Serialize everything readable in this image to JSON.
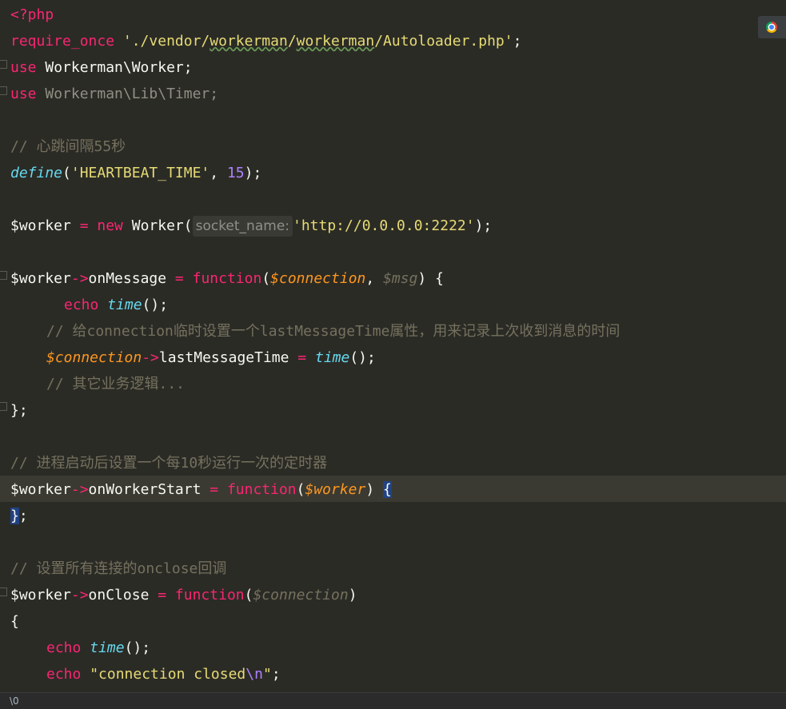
{
  "code": {
    "l1_open": "<?php",
    "l2_require": "require_once",
    "l2_path_a": " './vendor/",
    "l2_path_b": "workerman",
    "l2_path_c": "/",
    "l2_path_d": "workerman",
    "l2_path_e": "/Autoloader.php'",
    "l2_semi": ";",
    "l3_use": "use",
    "l3_ns": " Workerman\\Worker;",
    "l4_use": "use",
    "l4_ns": " Workerman\\Lib\\Timer;",
    "l6_comment": "// 心跳间隔55秒",
    "l7_define": "define",
    "l7_open": "(",
    "l7_str": "'HEARTBEAT_TIME'",
    "l7_comma": ", ",
    "l7_num": "15",
    "l7_close": ");",
    "l9_var": "$worker",
    "l9_eq": " = ",
    "l9_new": "new",
    "l9_cls": " Worker(",
    "l9_hint": "socket_name:",
    "l9_str": "'http://0.0.0.0:2222'",
    "l9_close": ");",
    "l11_var": "$worker",
    "l11_arrow": "->",
    "l11_prop": "onMessage",
    "l11_eq": " = ",
    "l11_fn": "function",
    "l11_open": "(",
    "l11_p1": "$connection",
    "l11_comma": ", ",
    "l11_p2": "$msg",
    "l11_close": ") {",
    "l12_echo": "echo",
    "l12_fn": "time",
    "l12_end": "();",
    "l13_comment": "// 给connection临时设置一个lastMessageTime属性，用来记录上次收到消息的时间",
    "l14_var": "$connection",
    "l14_arrow": "->",
    "l14_prop": "lastMessageTime",
    "l14_eq": " = ",
    "l14_fn": "time",
    "l14_end": "();",
    "l15_comment": "// 其它业务逻辑...",
    "l16_close": "};",
    "l18_comment": "// 进程启动后设置一个每10秒运行一次的定时器",
    "l19_var": "$worker",
    "l19_arrow": "->",
    "l19_prop": "onWorkerStart",
    "l19_eq": " = ",
    "l19_fn": "function",
    "l19_open": "(",
    "l19_p": "$worker",
    "l19_close": ") ",
    "l19_brace": "{",
    "l20_brace": "}",
    "l20_semi": ";",
    "l22_comment": "// 设置所有连接的onclose回调",
    "l23_var": "$worker",
    "l23_arrow": "->",
    "l23_prop": "onClose",
    "l23_eq": " = ",
    "l23_fn": "function",
    "l23_open": "(",
    "l23_p": "$connection",
    "l23_close": ")",
    "l24_brace": "{",
    "l25_echo": "echo",
    "l25_fn": "time",
    "l25_end": "();",
    "l26_echo": "echo",
    "l26_str_a": "\"connection closed",
    "l26_esc": "\\n",
    "l26_str_b": "\"",
    "l26_semi": ";"
  },
  "statusbar": {
    "text": "\\0"
  },
  "icons": {
    "browser": "chrome-icon"
  },
  "colors": {
    "background": "#2b2b26",
    "keyword": "#f92672",
    "string": "#e6db74",
    "comment": "#75715e",
    "function": "#66d9ef",
    "variable": "#fd971f"
  }
}
